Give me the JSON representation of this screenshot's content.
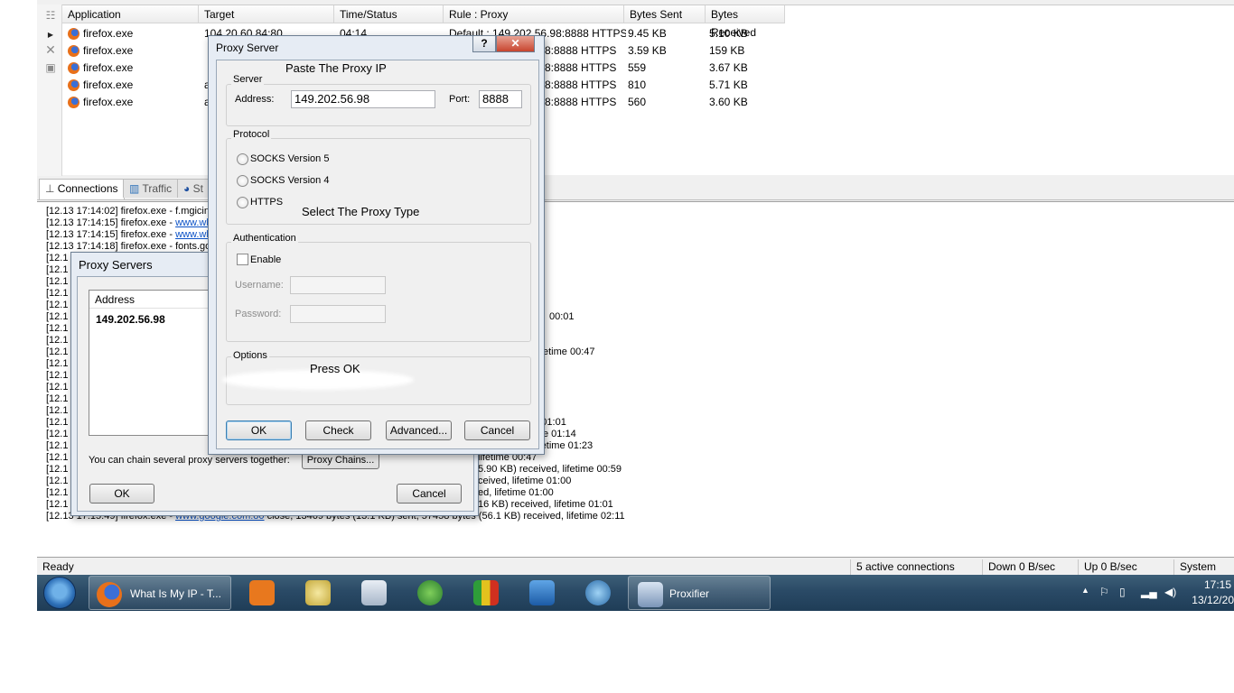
{
  "connections": {
    "columns": [
      "Application",
      "Target",
      "Time/Status",
      "Rule : Proxy",
      "Bytes Sent",
      "Bytes Received"
    ],
    "rows": [
      {
        "app": "firefox.exe",
        "target": "104.20.60.84:80",
        "time": "04:14",
        "rule": "Default : 149.202.56.98:8888 HTTPS",
        "sent": "9.45 KB",
        "received": "5.10 KB"
      },
      {
        "app": "firefox.exe",
        "target": "",
        "time": "",
        "rule": "8:8888 HTTPS",
        "sent": "3.59 KB",
        "received": "159 KB"
      },
      {
        "app": "firefox.exe",
        "target": "",
        "time": "",
        "rule": "8:8888 HTTPS",
        "sent": "559",
        "received": "3.67 KB"
      },
      {
        "app": "firefox.exe",
        "target": "a",
        "time": "",
        "rule": "8:8888 HTTPS",
        "sent": "810",
        "received": "5.71 KB"
      },
      {
        "app": "firefox.exe",
        "target": "a",
        "time": "",
        "rule": "8:8888 HTTPS",
        "sent": "560",
        "received": "3.60 KB"
      }
    ]
  },
  "tabs": [
    "Connections",
    "Traffic",
    "St"
  ],
  "log": {
    "lines": [
      {
        "prefix": "[12.13 17:14:02] firefox.exe - f.mgicinj",
        "link": "",
        "suffix": ""
      },
      {
        "prefix": "[12.13 17:14:15] firefox.exe - ",
        "link": "www.wh",
        "suffix": ""
      },
      {
        "prefix": "[12.13 17:14:15] firefox.exe - ",
        "link": "www.wh",
        "suffix": ""
      },
      {
        "prefix": "[12.13 17:14:18] firefox.exe - fonts.goo",
        "link": "",
        "suffix": ""
      },
      {
        "prefix": "[12.1",
        "link": "",
        "suffix": ""
      },
      {
        "prefix": "[12.1",
        "link": "",
        "suffix": ""
      },
      {
        "prefix": "[12.1",
        "link": "",
        "suffix": ""
      },
      {
        "prefix": "[12.1",
        "link": "",
        "suffix": ""
      },
      {
        "prefix": "[12.1",
        "link": "",
        "suffix": ""
      },
      {
        "prefix": "[12.1",
        "link": "",
        "suffix": "00:01"
      },
      {
        "prefix": "[12.1",
        "link": "",
        "suffix": ""
      },
      {
        "prefix": "[12.1",
        "link": "",
        "suffix": ""
      },
      {
        "prefix": "[12.1",
        "link": "",
        "suffix": "etime 00:47"
      },
      {
        "prefix": "[12.1",
        "link": "",
        "suffix": ""
      },
      {
        "prefix": "[12.1",
        "link": "",
        "suffix": ""
      },
      {
        "prefix": "[12.1",
        "link": "",
        "suffix": ""
      },
      {
        "prefix": "[12.1",
        "link": "",
        "suffix": ""
      },
      {
        "prefix": "[12.1",
        "link": "",
        "suffix": ""
      },
      {
        "prefix": "[12.1",
        "link": "",
        "suffix": "eived, lifetime 01:01"
      },
      {
        "prefix": "[12.1",
        "link": "",
        "suffix": "e 01:14"
      },
      {
        "prefix": "[12.1",
        "link": "",
        "suffix": "B) received, lifetime 01:23"
      },
      {
        "prefix": "[12.1",
        "link": "",
        "suffix": "lifetime 00:47"
      },
      {
        "prefix": "[12.1",
        "link": "",
        "suffix": "5.90 KB) received, lifetime 00:59"
      },
      {
        "prefix": "[12.1",
        "link": "",
        "suffix": "ceived, lifetime 01:00"
      },
      {
        "prefix": "[12.1",
        "link": "",
        "suffix": "ed, lifetime 01:00"
      },
      {
        "prefix": "[12.1",
        "link": "",
        "suffix": "16 KB) received, lifetime 01:01"
      },
      {
        "prefix": "[12.13 17:15:49] firefox.exe - ",
        "link": "www.google.com:80",
        "suffix": " close, 13469 bytes (13.1 KB) sent, 57458 bytes (56.1 KB) received, lifetime 02:11"
      }
    ]
  },
  "status": {
    "ready": "Ready",
    "connections": "5 active connections",
    "down": "Down 0 B/sec",
    "up": "Up 0 B/sec",
    "dns": "System DNS"
  },
  "taskbar": {
    "firefox_label": "What Is My IP - T...",
    "proxifier_label": "Proxifier",
    "time": "17:15",
    "date": "13/12/20"
  },
  "proxy_servers_dialog": {
    "title": "Proxy Servers",
    "address_header": "Address",
    "address_value": "149.202.56.98",
    "chain_text": "You can chain several proxy servers together:",
    "chain_button": "Proxy Chains...",
    "ok": "OK",
    "cancel": "Cancel"
  },
  "proxy_server_dialog": {
    "title": "Proxy Server",
    "help": "?",
    "close": "✕",
    "server_group": "Server",
    "address_label": "Address:",
    "address_value": "149.202.56.98",
    "port_label": "Port:",
    "port_value": "8888",
    "protocol_group": "Protocol",
    "protocols": [
      "SOCKS Version 5",
      "SOCKS Version 4",
      "HTTPS"
    ],
    "auth_group": "Authentication",
    "enable_label": "Enable",
    "username_label": "Username:",
    "password_label": "Password:",
    "options_group": "Options",
    "ok": "OK",
    "check": "Check",
    "advanced": "Advanced...",
    "cancel": "Cancel"
  },
  "annotations": {
    "paste_ip": "Paste The Proxy IP",
    "select_type": "Select The Proxy Type",
    "press_ok": "Press OK"
  }
}
